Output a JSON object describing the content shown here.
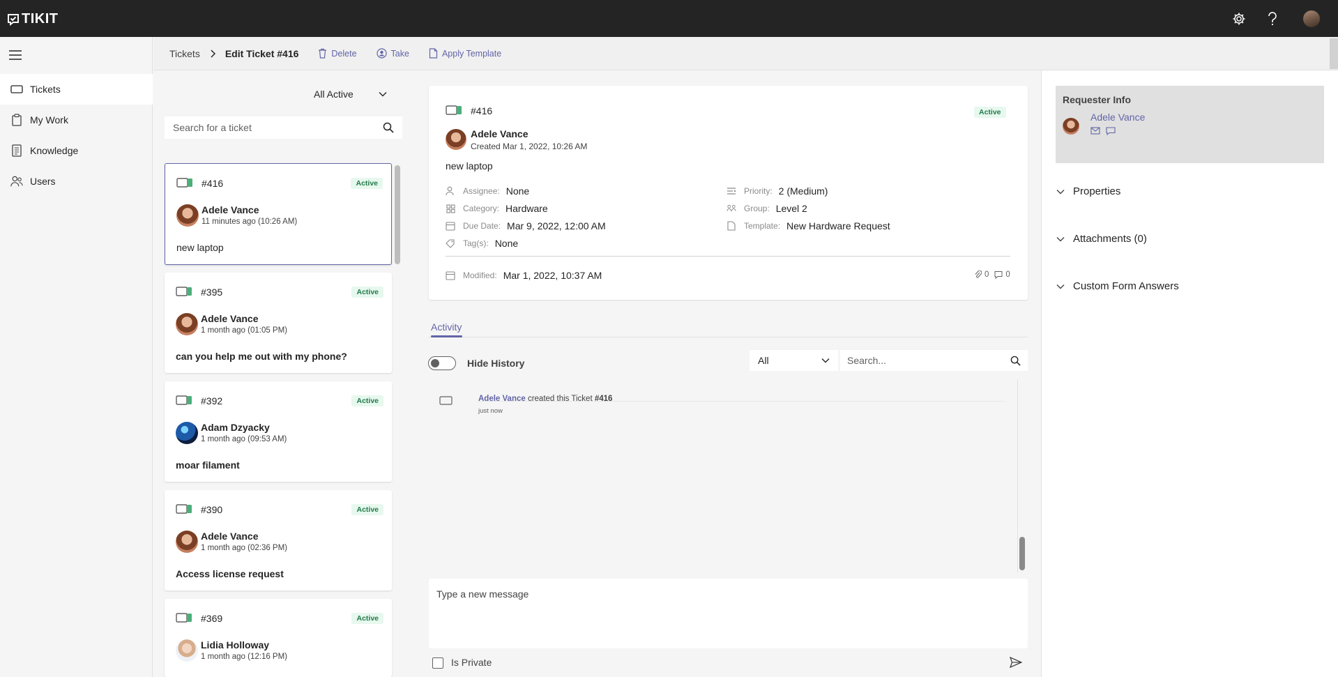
{
  "app": {
    "name": "TIKIT"
  },
  "topbar": {
    "icons": [
      "settings-icon",
      "help-icon",
      "user-avatar"
    ]
  },
  "nav": {
    "items": [
      {
        "label": "Tickets",
        "icon": "ticket-icon",
        "active": true
      },
      {
        "label": "My Work",
        "icon": "clipboard-icon",
        "active": false
      },
      {
        "label": "Knowledge",
        "icon": "document-icon",
        "active": false
      },
      {
        "label": "Users",
        "icon": "people-icon",
        "active": false
      }
    ]
  },
  "commandbar": {
    "breadcrumb_root": "Tickets",
    "breadcrumb_current": "Edit Ticket #416",
    "delete_label": "Delete",
    "take_label": "Take",
    "apply_template_label": "Apply Template"
  },
  "list": {
    "filter": "All Active",
    "search_placeholder": "Search for a ticket",
    "tickets": [
      {
        "id": "#416",
        "status": "Active",
        "name": "Adele Vance",
        "time": "11 minutes ago (10:26 AM)",
        "title": "new laptop"
      },
      {
        "id": "#395",
        "status": "Active",
        "name": "Adele Vance",
        "time": "1 month ago (01:05 PM)",
        "title": "can you help me out with my phone?"
      },
      {
        "id": "#392",
        "status": "Active",
        "name": "Adam Dzyacky",
        "time": "1 month ago (09:53 AM)",
        "title": "moar filament"
      },
      {
        "id": "#390",
        "status": "Active",
        "name": "Adele Vance",
        "time": "1 month ago (02:36 PM)",
        "title": "Access license request"
      },
      {
        "id": "#369",
        "status": "Active",
        "name": "Lidia Holloway",
        "time": "1 month ago (12:16 PM)",
        "title": ""
      }
    ]
  },
  "ticket": {
    "id": "#416",
    "status": "Active",
    "requester": "Adele Vance",
    "created": "Created Mar 1, 2022, 10:26 AM",
    "title": "new laptop",
    "assignee_label": "Assignee:",
    "assignee": "None",
    "category_label": "Category:",
    "category": "Hardware",
    "due_label": "Due Date:",
    "due": "Mar 9, 2022, 12:00 AM",
    "tags_label": "Tag(s):",
    "tags": "None",
    "priority_label": "Priority:",
    "priority": "2 (Medium)",
    "group_label": "Group:",
    "group": "Level 2",
    "template_label": "Template:",
    "template": "New Hardware Request",
    "modified_label": "Modified:",
    "modified": "Mar 1, 2022, 10:37 AM",
    "attachments_count": "0",
    "comments_count": "0"
  },
  "activity": {
    "tab": "Activity",
    "hide_history": "Hide History",
    "filter": "All",
    "search_placeholder": "Search...",
    "entries": [
      {
        "user": "Adele Vance",
        "action": " created this Ticket ",
        "ticket": "#416",
        "time": "just now"
      }
    ],
    "compose_placeholder": "Type a new message",
    "is_private": "Is Private"
  },
  "right": {
    "requester_title": "Requester Info",
    "requester_name": "Adele Vance",
    "sections": [
      "Properties",
      "Attachments (0)",
      "Custom Form Answers"
    ]
  },
  "colors": {
    "accent": "#6264a7",
    "topbar": "#242424",
    "active_badge_bg": "#e7f8ee",
    "active_badge_text": "#237b4b",
    "ticket_green": "#4caf7a"
  }
}
